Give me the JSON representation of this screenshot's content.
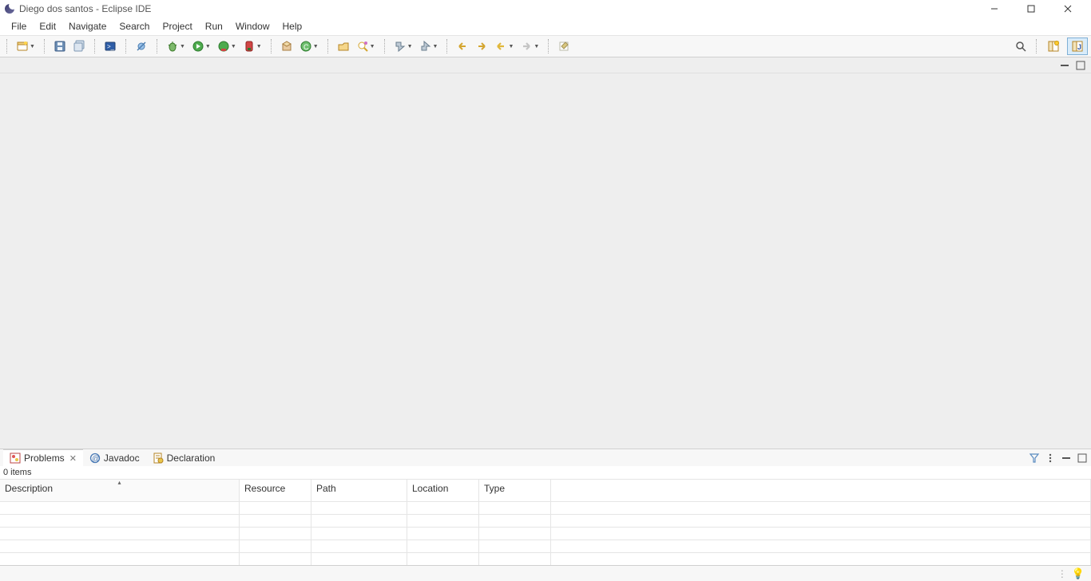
{
  "title": "Diego dos santos - Eclipse IDE",
  "menubar": [
    "File",
    "Edit",
    "Navigate",
    "Search",
    "Project",
    "Run",
    "Window",
    "Help"
  ],
  "bottom": {
    "tabs": [
      {
        "label": "Problems",
        "active": true
      },
      {
        "label": "Javadoc",
        "active": false
      },
      {
        "label": "Declaration",
        "active": false
      }
    ],
    "items_count": "0 items",
    "columns": [
      "Description",
      "Resource",
      "Path",
      "Location",
      "Type"
    ]
  }
}
